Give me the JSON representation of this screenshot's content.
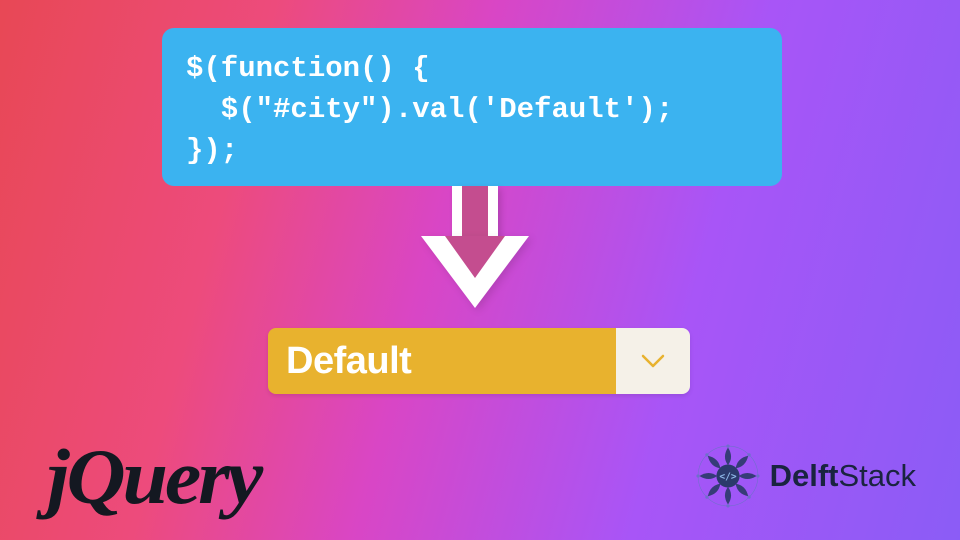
{
  "code": {
    "line1": "$(function() {",
    "line2": "  $(\"#city\").val('Default');",
    "line3": "});"
  },
  "dropdown": {
    "value": "Default"
  },
  "logos": {
    "jquery": "jQuery",
    "delftstack_prefix": "Delft",
    "delftstack_suffix": "Stack"
  }
}
